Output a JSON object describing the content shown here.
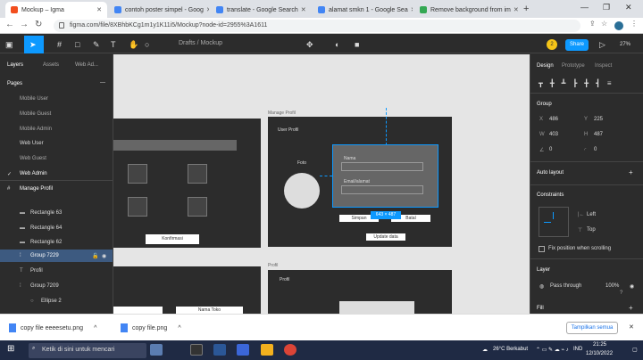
{
  "browser": {
    "tabs": [
      {
        "label": "Mockup – Igma",
        "color": "#f24e1e"
      },
      {
        "label": "contoh poster simpel - Goog",
        "color": "#4285f4"
      },
      {
        "label": "translate - Google Search",
        "color": "#4285f4"
      },
      {
        "label": "alamat smkn 1 - Google Sea",
        "color": "#4285f4"
      },
      {
        "label": "Remove background from im",
        "color": "#34a853"
      }
    ],
    "url": "figma.com/file/8XBhbKCg1m1y1K11i5/Mockup?node-id=2955%3A1611"
  },
  "toolbar": {
    "doc_title": "Drafts / Mockup",
    "share_label": "Share",
    "zoom": "27%",
    "avatar": "2"
  },
  "left": {
    "tabs": [
      "Layers",
      "Assets",
      "Web Ad..."
    ],
    "pages_label": "Pages",
    "pages": [
      "Mobile User",
      "Mobile Guest",
      "Mobile Admin",
      "Web User",
      "Web Guest",
      "Web Admin"
    ],
    "layers": [
      "Manage Profil",
      "Rectangle 63",
      "Rectangle 64",
      "Rectangle 62",
      "Group 7229",
      "Profil",
      "Group 7209",
      "Ellipse 2"
    ]
  },
  "canvas": {
    "frame1_label": "Manage Profil",
    "frame2_label": "Profil",
    "user_profil": "User Profil",
    "foto": "Foto",
    "nama": "Nama",
    "email": "Email/alamat",
    "save": "Simpan",
    "cancel": "Batal",
    "update": "Update data",
    "confirm": "Konfirmasi",
    "size_badge": "643 × 487",
    "profil_title": "Profil",
    "nama_toko": "Nama Toko"
  },
  "right": {
    "tabs": [
      "Design",
      "Prototype",
      "Inspect"
    ],
    "group": "Group",
    "x_label": "X",
    "x_val": "486",
    "y_label": "Y",
    "y_val": "225",
    "w_label": "W",
    "w_val": "403",
    "h_label": "H",
    "h_val": "487",
    "r_val": "0",
    "c_val": "0",
    "auto_layout": "Auto layout",
    "constraints": "Constraints",
    "left_opt": "Left",
    "top_opt": "Top",
    "fix_scroll": "Fix position when scrolling",
    "layer": "Layer",
    "pass_through": "Pass through",
    "opacity": "100%",
    "fill": "Fill"
  },
  "downloads": [
    {
      "label": "copy file eeeesetu.png"
    },
    {
      "label": "copy file.png"
    }
  ],
  "downloads_show_all": "Tampilkan semua",
  "taskbar": {
    "search": "Ketik di sini untuk mencari",
    "weather": "26°C Berkabut",
    "lang": "IND",
    "time": "21:25",
    "date": "12/10/2022"
  }
}
